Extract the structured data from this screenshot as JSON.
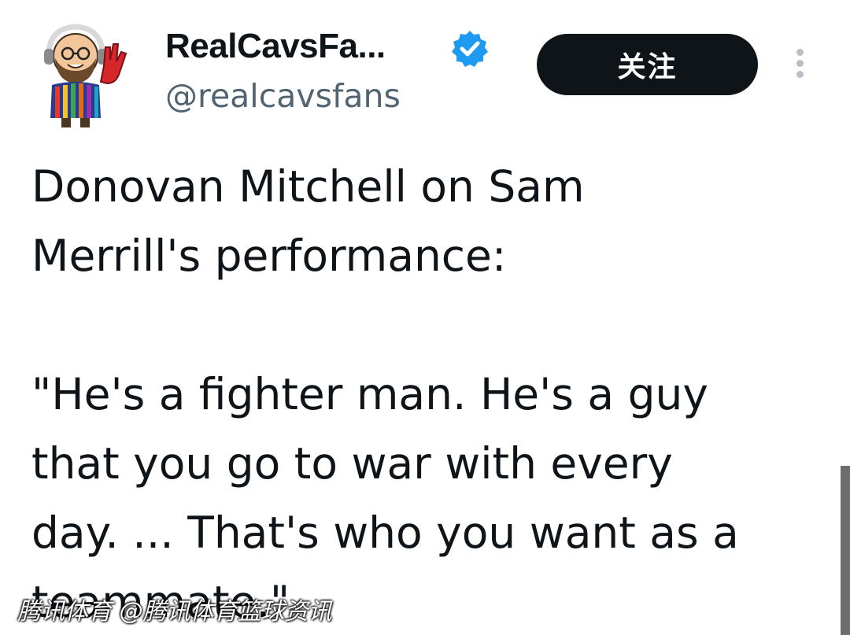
{
  "tweet": {
    "author": {
      "display_name": "RealCavsFa...",
      "handle": "@realcavsfans",
      "verified": true,
      "avatar_icon": "cartoon-fan-avatar-icon"
    },
    "follow_label": "关注",
    "more_icon": "more-vertical-icon",
    "text_lines": [
      "Donovan Mitchell on Sam\nMerrill's performance:",
      "\"He's a fighter man. He's a guy\nthat you go to war with every\nday. ... That's who you want as a\nteammate.\""
    ]
  },
  "watermark": "腾讯体育 @腾讯体育篮球资讯",
  "colors": {
    "text": "#0f1419",
    "handle": "#536471",
    "follow_bg": "#0f1419",
    "verified_badge": "#1d9bf0"
  }
}
